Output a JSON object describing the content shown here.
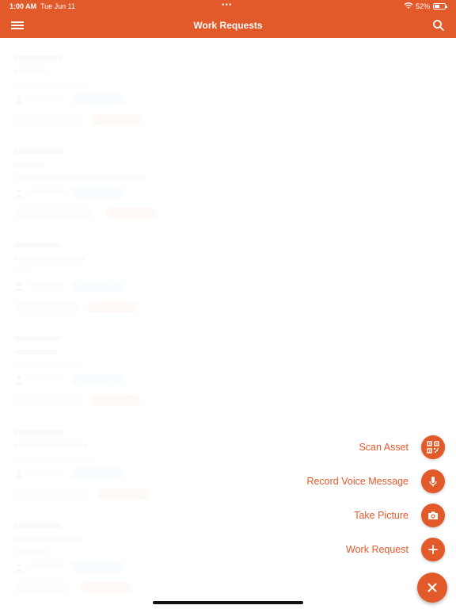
{
  "status_bar": {
    "time": "1:00 AM",
    "date": "Tue Jun 11",
    "battery": "52%",
    "battery_level": 0.52
  },
  "nav": {
    "title": "Work Requests",
    "menu_icon": "hamburger-menu-icon",
    "search_icon": "search-icon"
  },
  "fab_menu": {
    "items": [
      {
        "label": "Scan Asset",
        "icon": "qr-code-icon"
      },
      {
        "label": "Record Voice Message",
        "icon": "microphone-icon"
      },
      {
        "label": "Take Picture",
        "icon": "camera-icon"
      },
      {
        "label": "Work Request",
        "icon": "plus-icon"
      }
    ],
    "close_icon": "close-icon"
  },
  "colors": {
    "accent": "#e2592a",
    "background": "#ffffff"
  }
}
